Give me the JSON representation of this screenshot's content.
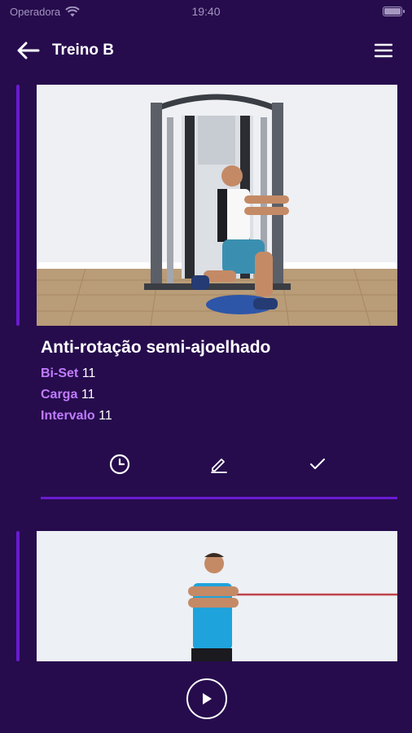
{
  "status_bar": {
    "carrier": "Operadora",
    "time": "19:40"
  },
  "header": {
    "title": "Treino B"
  },
  "exercises": [
    {
      "name": "Anti-rotação semi-ajoelhado",
      "bi_set_label": "Bi-Set",
      "bi_set_value": "11",
      "carga_label": "Carga",
      "carga_value": "11",
      "intervalo_label": "Intervalo",
      "intervalo_value": "11"
    }
  ],
  "colors": {
    "background": "#260c4d",
    "accent": "#6a1bd1",
    "label": "#c07bff"
  },
  "icons": {
    "back": "arrow-left-icon",
    "menu": "hamburger-menu-icon",
    "timer": "clock-icon",
    "edit": "pencil-icon",
    "done": "check-icon",
    "play": "play-icon"
  }
}
